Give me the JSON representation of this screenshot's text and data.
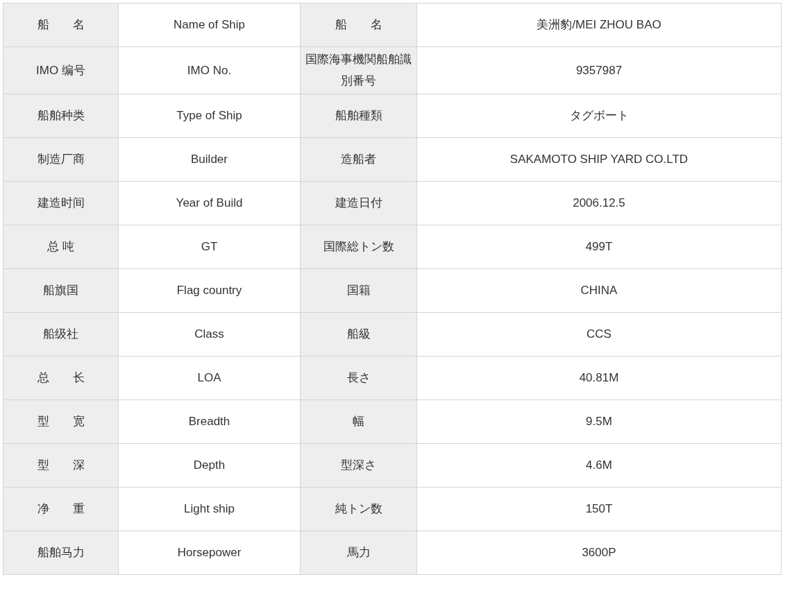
{
  "table": {
    "rows": [
      {
        "label_zh": "船　　名",
        "label_en": "Name of Ship",
        "label_ja": "船　　名",
        "value": "美洲豹/MEI ZHOU BAO"
      },
      {
        "label_zh": "IMO 编号",
        "label_en": "IMO No.",
        "label_ja": "国際海事機関船舶識別番号",
        "value": "9357987"
      },
      {
        "label_zh": "船舶种类",
        "label_en": "Type of Ship",
        "label_ja": "船舶種類",
        "value": "タグボート"
      },
      {
        "label_zh": "制造厂商",
        "label_en": "Builder",
        "label_ja": "造船者",
        "value": "SAKAMOTO SHIP YARD CO.LTD"
      },
      {
        "label_zh": "建造时间",
        "label_en": "Year of Build",
        "label_ja": "建造日付",
        "value": "2006.12.5"
      },
      {
        "label_zh": "总 吨",
        "label_en": "GT",
        "label_ja": "国際総トン数",
        "value": "499T"
      },
      {
        "label_zh": "船旗国",
        "label_en": "Flag country",
        "label_ja": "国籍",
        "value": "CHINA"
      },
      {
        "label_zh": "船级社",
        "label_en": "Class",
        "label_ja": "船級",
        "value": "CCS"
      },
      {
        "label_zh": "总　　长",
        "label_en": "LOA",
        "label_ja": "長さ",
        "value": "40.81M"
      },
      {
        "label_zh": "型　　宽",
        "label_en": "Breadth",
        "label_ja": "幅",
        "value": "9.5M"
      },
      {
        "label_zh": "型　　深",
        "label_en": "Depth",
        "label_ja": "型深さ",
        "value": "4.6M"
      },
      {
        "label_zh": "净　　重",
        "label_en": "Light ship",
        "label_ja": "純トン数",
        "value": "150T"
      },
      {
        "label_zh": "船舶马力",
        "label_en": "Horsepower",
        "label_ja": "馬力",
        "value": "3600P"
      }
    ]
  }
}
